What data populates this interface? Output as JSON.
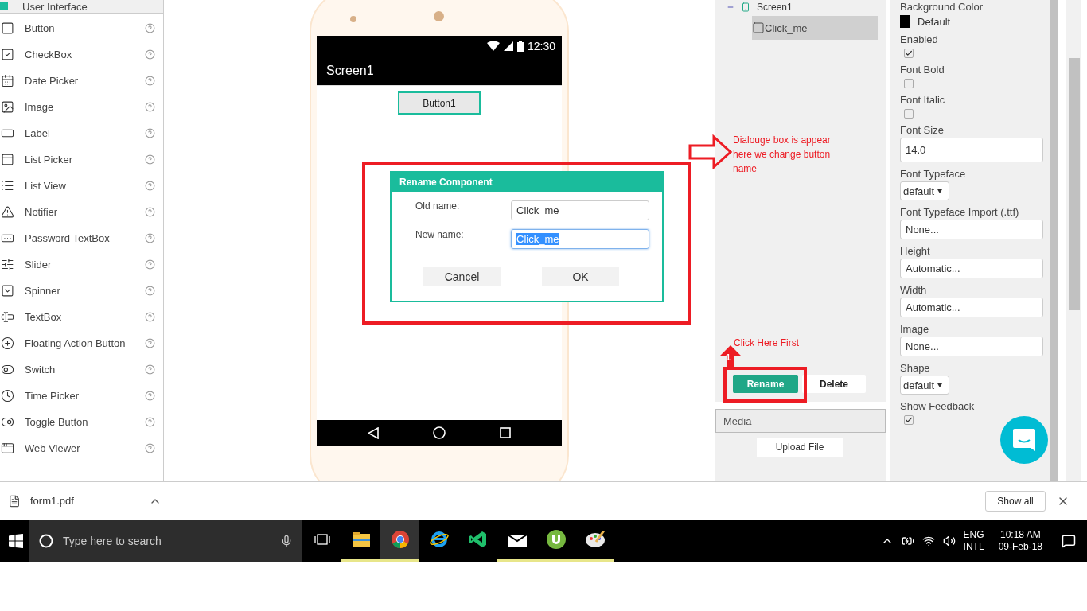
{
  "palette": {
    "header": "User Interface",
    "items": [
      {
        "label": "Button",
        "kind": "button"
      },
      {
        "label": "CheckBox",
        "kind": "checkbox"
      },
      {
        "label": "Date Picker",
        "kind": "datepicker"
      },
      {
        "label": "Image",
        "kind": "image"
      },
      {
        "label": "Label",
        "kind": "label"
      },
      {
        "label": "List Picker",
        "kind": "listpicker"
      },
      {
        "label": "List View",
        "kind": "listview"
      },
      {
        "label": "Notifier",
        "kind": "notifier"
      },
      {
        "label": "Password TextBox",
        "kind": "password"
      },
      {
        "label": "Slider",
        "kind": "slider"
      },
      {
        "label": "Spinner",
        "kind": "spinner"
      },
      {
        "label": "TextBox",
        "kind": "textbox"
      },
      {
        "label": "Floating Action Button",
        "kind": "fab"
      },
      {
        "label": "Switch",
        "kind": "switch"
      },
      {
        "label": "Time Picker",
        "kind": "timepicker"
      },
      {
        "label": "Toggle Button",
        "kind": "toggle"
      },
      {
        "label": "Web Viewer",
        "kind": "webviewer"
      }
    ]
  },
  "phone": {
    "time": "12:30",
    "title": "Screen1",
    "button": "Button1"
  },
  "dialog": {
    "title": "Rename Component",
    "fields": [
      {
        "label": "Old name:",
        "value": "Click_me",
        "focused": false
      },
      {
        "label": "New name:",
        "value": "Click_me",
        "focused": true
      }
    ],
    "buttons": [
      "Cancel",
      "OK"
    ]
  },
  "components": {
    "tree": [
      {
        "label": "Screen1",
        "expanded": true,
        "children": [
          {
            "label": "Click_me",
            "selected": true
          }
        ]
      }
    ],
    "buttons": [
      {
        "label": "Rename",
        "kind": "primary"
      },
      {
        "label": "Delete",
        "kind": "plain"
      }
    ]
  },
  "media": {
    "title": "Media",
    "button": "Upload File"
  },
  "properties": [
    {
      "label": "Background Color",
      "kind": "color",
      "value": "Default",
      "color": "#000000"
    },
    {
      "label": "Enabled",
      "kind": "checkbox",
      "checked": true
    },
    {
      "label": "Font Bold",
      "kind": "checkbox",
      "checked": false
    },
    {
      "label": "Font Italic",
      "kind": "checkbox",
      "checked": false
    },
    {
      "label": "Font Size",
      "kind": "text",
      "value": "14.0"
    },
    {
      "label": "Font Typeface",
      "kind": "select",
      "value": "default"
    },
    {
      "label": "Font Typeface Import (.ttf)",
      "kind": "picker",
      "value": "None..."
    },
    {
      "label": "Height",
      "kind": "picker",
      "value": "Automatic..."
    },
    {
      "label": "Width",
      "kind": "picker",
      "value": "Automatic..."
    },
    {
      "label": "Image",
      "kind": "picker",
      "value": "None..."
    },
    {
      "label": "Shape",
      "kind": "select",
      "value": "default"
    },
    {
      "label": "Show Feedback",
      "kind": "checkbox",
      "checked": true
    }
  ],
  "annotations": {
    "dialog_note": "Dialouge box is appear here we change button name",
    "step_note": "Click Here First",
    "step": "1"
  },
  "downloads": {
    "file": "form1.pdf",
    "show_all": "Show all"
  },
  "taskbar": {
    "search_placeholder": "Type here to search",
    "language": "ENG",
    "layout": "INTL",
    "time": "10:18 AM",
    "date": "09-Feb-18"
  }
}
